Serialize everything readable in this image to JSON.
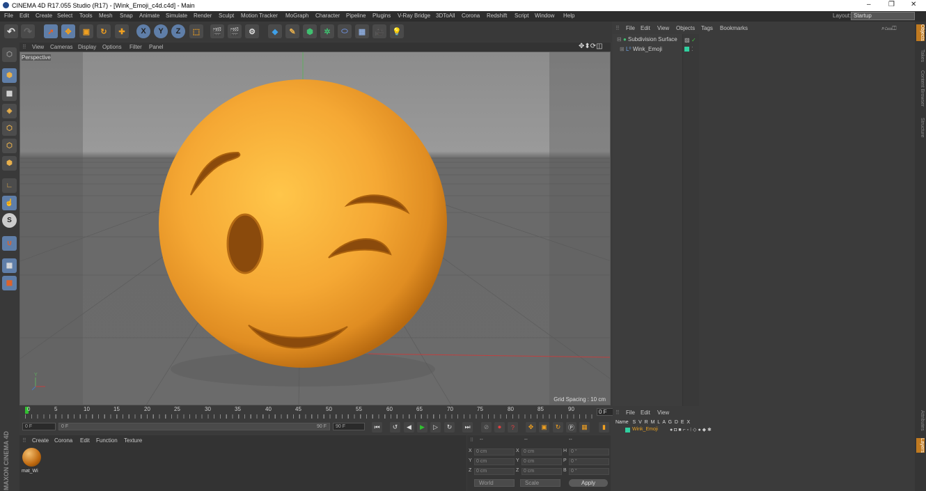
{
  "window": {
    "title": "CINEMA 4D R17.055 Studio (R17) - [Wink_Emoji_c4d.c4d] - Main",
    "controls": [
      "–",
      "❐",
      "✕"
    ]
  },
  "menu": [
    "File",
    "Edit",
    "Create",
    "Select",
    "Tools",
    "Mesh",
    "Snap",
    "Animate",
    "Simulate",
    "Render",
    "Sculpt",
    "Motion Tracker",
    "MoGraph",
    "Character",
    "Pipeline",
    "Plugins",
    "V-Ray Bridge",
    "3DToAll",
    "Corona",
    "Redshift",
    "Script",
    "Window",
    "Help"
  ],
  "layout": {
    "label": "Layout:",
    "value": "Startup"
  },
  "toolbar": {
    "undo": "↶",
    "redo": "↷",
    "tools": [
      "select",
      "move",
      "scale",
      "rotate",
      "live",
      "X",
      "Y",
      "Z",
      "coord",
      "render-view",
      "render",
      "render-settings",
      "cube",
      "pen",
      "subdivision",
      "cloner",
      "deformer",
      "floor",
      "camera",
      "light"
    ]
  },
  "viewport": {
    "menu": [
      "View",
      "Cameras",
      "Display",
      "Options",
      "Filter",
      "Panel"
    ],
    "camera_label": "Perspective",
    "grid_spacing": "Grid Spacing : 10 cm",
    "nav_icons": "✥⬍⟳◫"
  },
  "timeline": {
    "ticks": [
      "0",
      "5",
      "10",
      "15",
      "20",
      "25",
      "30",
      "35",
      "40",
      "45",
      "50",
      "55",
      "60",
      "65",
      "70",
      "75",
      "80",
      "85",
      "90"
    ],
    "current_frame": "0 F"
  },
  "transport": {
    "start": "0 F",
    "range_start": "0 F",
    "range_end": "90 F",
    "end": "90 F"
  },
  "material_manager": {
    "menu": [
      "Create",
      "Corona",
      "Edit",
      "Function",
      "Texture"
    ],
    "material_name": "mat_Wi"
  },
  "coordinates": {
    "header": [
      "--",
      "--",
      "--"
    ],
    "rows": [
      {
        "a": "X",
        "pos": "0 cm",
        "b": "X",
        "size": "0 cm",
        "c": "H",
        "rot": "0 °"
      },
      {
        "a": "Y",
        "pos": "0 cm",
        "b": "Y",
        "size": "0 cm",
        "c": "P",
        "rot": "0 °"
      },
      {
        "a": "Z",
        "pos": "0 cm",
        "b": "Z",
        "size": "0 cm",
        "c": "B",
        "rot": "0 °"
      }
    ],
    "mode": "World",
    "scale": "Scale",
    "apply": "Apply"
  },
  "object_manager": {
    "menu": [
      "File",
      "Edit",
      "View",
      "Objects",
      "Tags",
      "Bookmarks"
    ],
    "objects": [
      {
        "name": "Subdivision Surface"
      },
      {
        "name": "Wink_Emoji"
      }
    ]
  },
  "layer_manager": {
    "menu": [
      "File",
      "Edit",
      "View"
    ],
    "header": "Name   S  V  R  M  L  A  G  D  E  X",
    "layer_name": "Wink_Emoji"
  },
  "right_tabs": [
    "Objects",
    "Takes",
    "Content Browser",
    "Structure",
    "Attributes",
    "Layers"
  ],
  "brand": "MAXON CINEMA 4D",
  "colors": {
    "accent": "#5f7ea8",
    "emoji": "#f0a830",
    "layer": "#e8a020"
  }
}
